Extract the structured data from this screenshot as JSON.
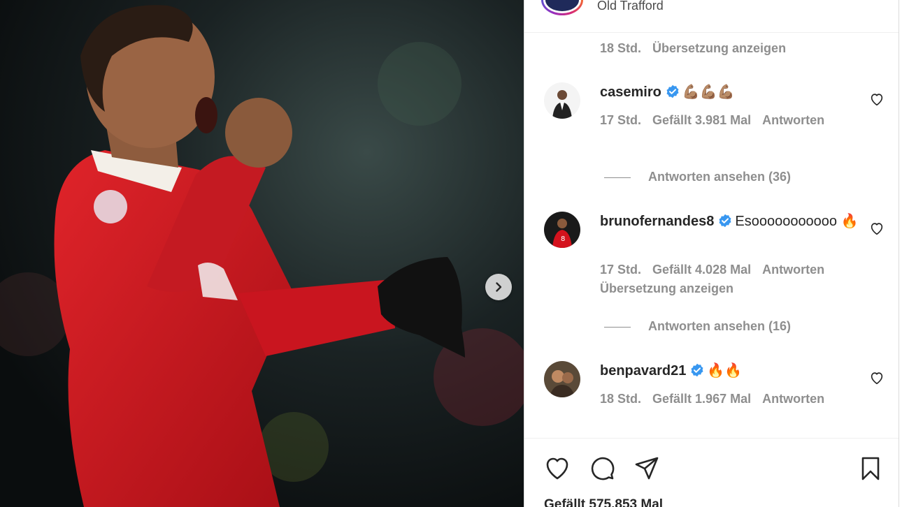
{
  "post": {
    "location": "Old Trafford",
    "caption_meta": {
      "time": "18 Std.",
      "translate": "Übersetzung anzeigen"
    },
    "likes_text": "Gefällt 575.853 Mal"
  },
  "comments": [
    {
      "user": "casemiro",
      "verified": true,
      "text": "💪🏽💪🏽💪🏽",
      "time": "17 Std.",
      "likes": "Gefällt 3.981 Mal",
      "reply": "Antworten",
      "view_replies": "Antworten ansehen (36)"
    },
    {
      "user": "brunofernandes8",
      "verified": true,
      "text": "Esooooooooooo 🔥",
      "time": "17 Std.",
      "likes": "Gefällt 4.028 Mal",
      "reply": "Antworten",
      "translate": "Übersetzung anzeigen",
      "view_replies": "Antworten ansehen (16)"
    },
    {
      "user": "benpavard21",
      "verified": true,
      "text": "🔥🔥",
      "time": "18 Std.",
      "likes": "Gefällt 1.967 Mal",
      "reply": "Antworten"
    }
  ],
  "icons": {
    "next": "chevron-right-icon",
    "like": "heart-icon",
    "comment": "comment-icon",
    "share": "send-icon",
    "save": "bookmark-icon"
  },
  "colors": {
    "verified": "#3897f0",
    "meta_gray": "#8e8e8e",
    "jersey_red": "#d4121d"
  }
}
